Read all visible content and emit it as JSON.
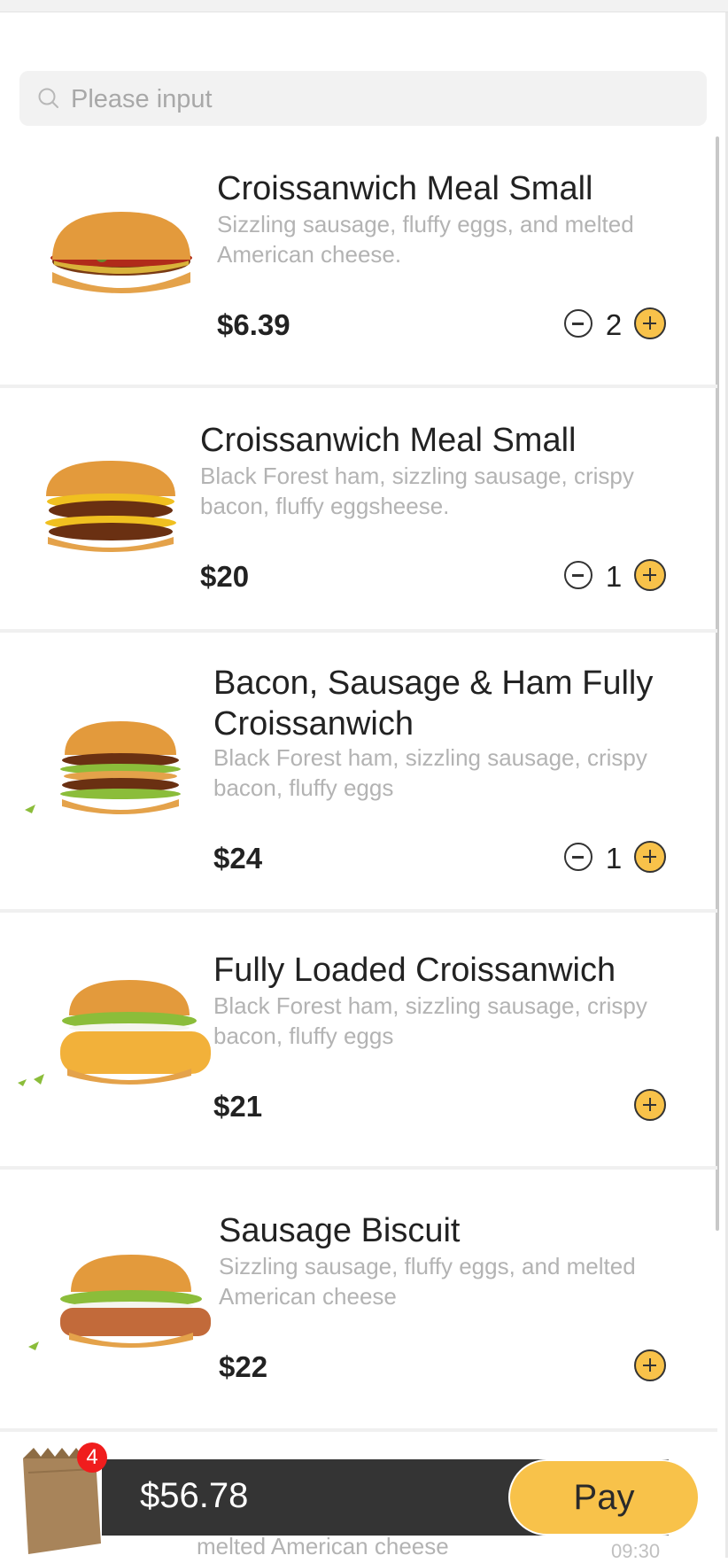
{
  "search": {
    "placeholder": "Please input"
  },
  "items": [
    {
      "name": "Croissanwich Meal Small",
      "desc": "Sizzling sausage, fluffy eggs, and melted American cheese.",
      "price": "$6.39",
      "qty": "2"
    },
    {
      "name": "Croissanwich Meal Small",
      "desc": "Black Forest ham, sizzling sausage, crispy bacon, fluffy eggsheese.",
      "price": "$20",
      "qty": "1"
    },
    {
      "name": "Bacon, Sausage & Ham Fully Croissanwich",
      "desc": "Black Forest ham, sizzling sausage, crispy bacon, fluffy eggs",
      "price": "$24",
      "qty": "1"
    },
    {
      "name": "Fully Loaded Croissanwich",
      "desc": "Black Forest ham, sizzling sausage, crispy bacon, fluffy eggs",
      "price": "$21"
    },
    {
      "name": "Sausage Biscuit",
      "desc": "Sizzling sausage, fluffy eggs, and melted American cheese",
      "price": "$22"
    }
  ],
  "partial_item": {
    "desc": "melted American cheese",
    "time": "09:30"
  },
  "cart": {
    "count": "4",
    "total": "$56.78",
    "pay_label": "Pay"
  },
  "colors": {
    "accent": "#f8c24a",
    "bar": "#343434",
    "badge": "#f01d1d"
  }
}
